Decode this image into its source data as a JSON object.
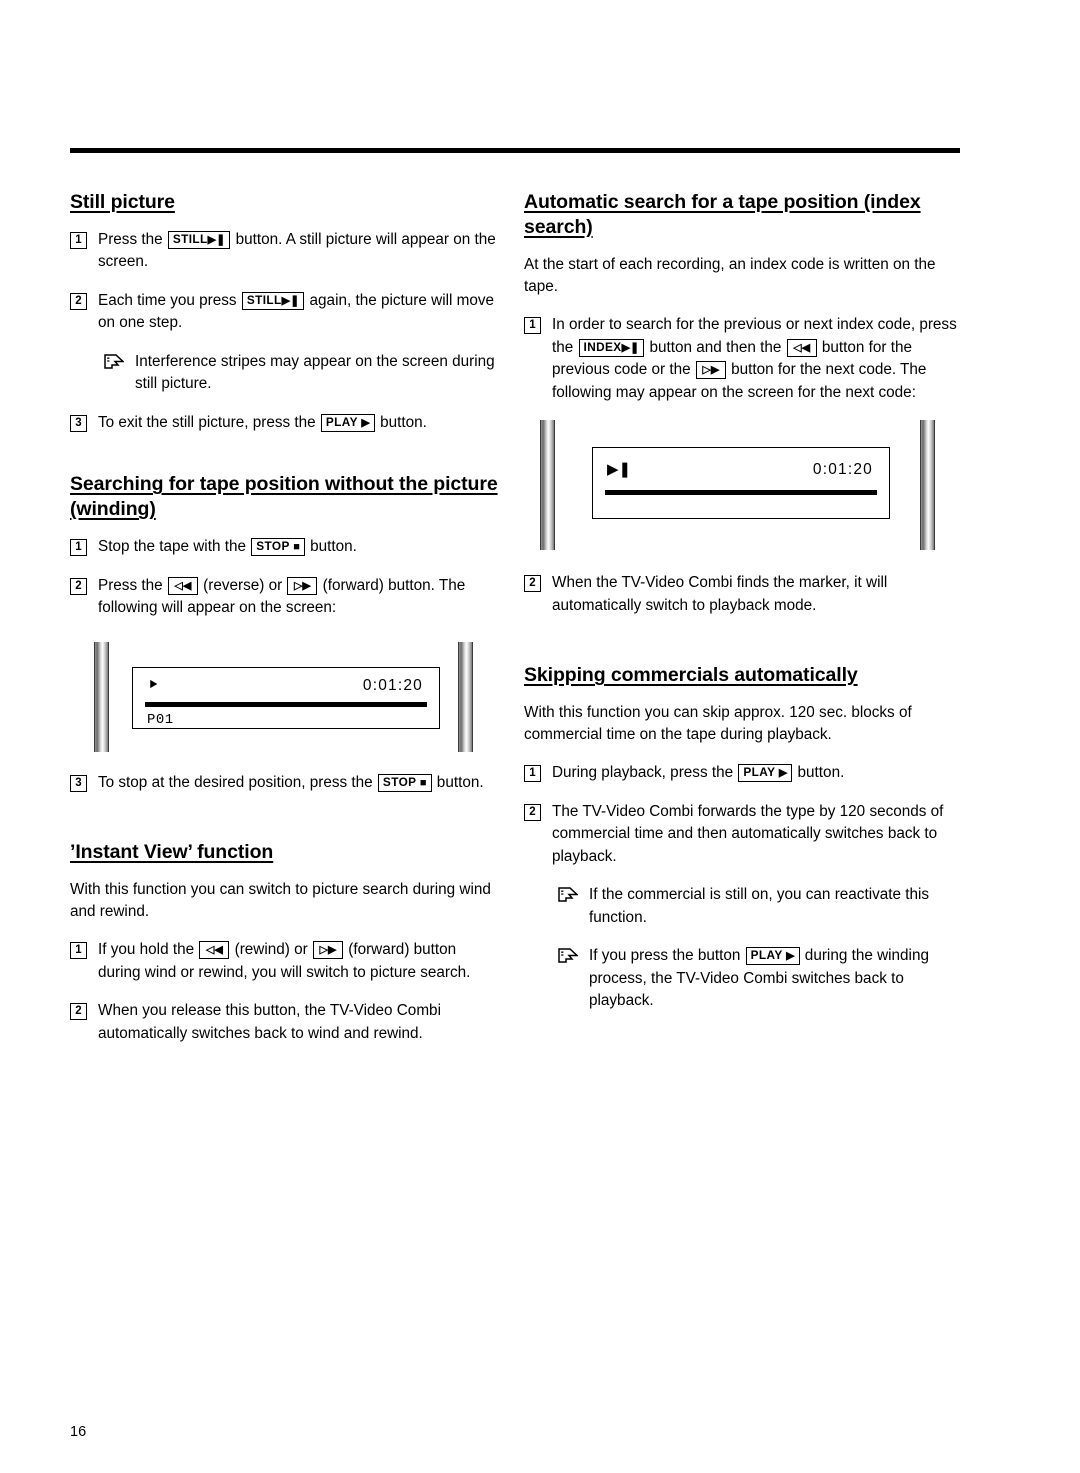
{
  "page": {
    "number": "16"
  },
  "left": {
    "section1": {
      "heading": "Still picture",
      "steps": [
        {
          "num": "1",
          "parts": [
            "Press the ",
            "STILL",
            " button. A still picture will appear on the screen."
          ]
        },
        {
          "num": "2",
          "parts": [
            "Each time you press ",
            "STILL",
            " again, the picture will move on one step."
          ]
        },
        {
          "num": "3",
          "parts": [
            "To exit the still picture, press the ",
            "PLAY",
            " button."
          ]
        }
      ],
      "note": "Interference stripes may appear on the screen during still picture."
    },
    "section2": {
      "heading": "Searching for tape position without the picture (winding)",
      "step1": {
        "num": "1",
        "pre": "Stop the tape with the ",
        "key": "STOP",
        "post": " button."
      },
      "step2": {
        "num": "2",
        "pre": "Press the ",
        "key1": "◁◀",
        "mid": " (reverse) or ",
        "key2": "▷▶",
        "post": " (forward) button. The following will appear on the screen:"
      },
      "osd": {
        "glyph": "⯈",
        "time": "0:01:20",
        "program": "P01"
      },
      "step3": {
        "num": "3",
        "pre": "To stop at the desired position, press the ",
        "key": "STOP",
        "post": " button."
      }
    },
    "section3": {
      "heading": "’Instant View’ function",
      "intro": "With this function you can switch to picture search during wind and rewind.",
      "step1": {
        "num": "1",
        "pre": "If you hold the ",
        "key1": "◁◀",
        "mid": " (rewind) or ",
        "key2": "▷▶",
        "post": " (forward) button during wind or rewind, you will switch to picture search."
      },
      "step2": {
        "num": "2",
        "text": "When you release this button, the TV-Video Combi automatically switches back to wind and rewind."
      }
    }
  },
  "right": {
    "section1": {
      "heading": "Automatic search for a tape position (index search)",
      "intro": "At the start of each recording, an index code is written on the tape.",
      "step1": {
        "num": "1",
        "t1": "In order to search for the previous or next index code, press the ",
        "key1": "INDEX",
        "t2": " button and then the ",
        "key2": "◁◀",
        "t3": " button for the previous code or the ",
        "key3": "▷▶",
        "t4": " button for the next code. The following may appear on the screen for the next code:"
      },
      "osd": {
        "glyph": "▶❚",
        "time": "0:01:20"
      },
      "step2": {
        "num": "2",
        "text": "When the TV-Video Combi finds the marker, it will automatically switch to playback mode."
      }
    },
    "section2": {
      "heading": "Skipping commercials automatically",
      "intro": "With this function you can skip approx. 120 sec. blocks of commercial time on the tape during playback.",
      "step1": {
        "num": "1",
        "pre": "During playback, press the ",
        "key": "PLAY",
        "post": " button."
      },
      "step2": {
        "num": "2",
        "text": "The TV-Video Combi forwards the type by 120 seconds of commercial time and then automatically switches back to playback."
      },
      "note1": "If the commercial is still on, you can reactivate this function.",
      "note2": {
        "pre": "If you press the button ",
        "key": "PLAY",
        "post": " during the winding process, the TV-Video Combi switches back to playback."
      }
    }
  },
  "keys": {
    "still_label": "STILL",
    "still_glyph": "▶❚",
    "play_label": "PLAY",
    "play_glyph": "▶",
    "stop_label": "STOP",
    "stop_glyph": "■",
    "index_label": "INDEX",
    "index_glyph": "▶❚",
    "rev_glyph": "◁◀",
    "fwd_glyph": "▷▶"
  },
  "colors": {
    "ink": "#000000",
    "paper": "#ffffff"
  }
}
